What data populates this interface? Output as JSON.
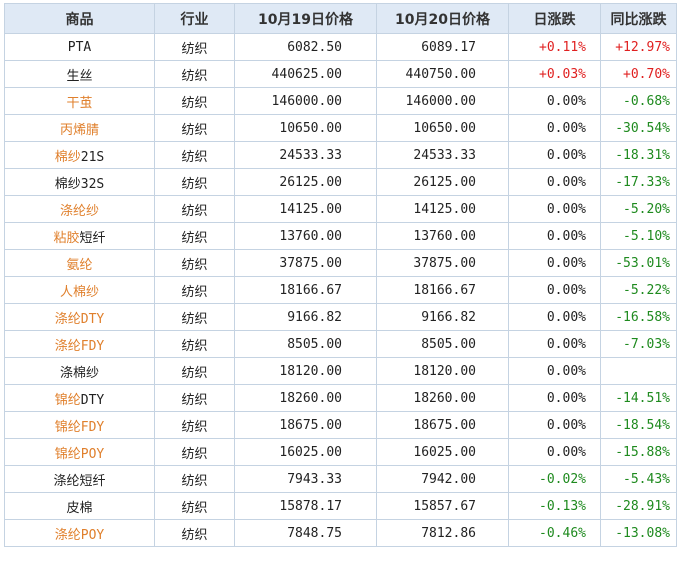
{
  "headers": [
    "商品",
    "行业",
    "10月19日价格",
    "10月20日价格",
    "日涨跌",
    "同比涨跌"
  ],
  "rows": [
    {
      "name": "PTA",
      "link": "",
      "industry": "纺织",
      "p19": "6082.50",
      "p20": "6089.17",
      "day": "+0.11%",
      "yoy": "+12.97%",
      "day_dir": "up",
      "yoy_dir": "up"
    },
    {
      "name": "生丝",
      "link": "",
      "industry": "纺织",
      "p19": "440625.00",
      "p20": "440750.00",
      "day": "+0.03%",
      "yoy": "+0.70%",
      "day_dir": "up",
      "yoy_dir": "up"
    },
    {
      "name": "",
      "link": "干茧",
      "industry": "纺织",
      "p19": "146000.00",
      "p20": "146000.00",
      "day": "0.00%",
      "yoy": "-0.68%",
      "day_dir": "flat",
      "yoy_dir": "down"
    },
    {
      "name": "",
      "link": "丙烯腈",
      "industry": "纺织",
      "p19": "10650.00",
      "p20": "10650.00",
      "day": "0.00%",
      "yoy": "-30.54%",
      "day_dir": "flat",
      "yoy_dir": "down"
    },
    {
      "name": "21S",
      "link": "棉纱",
      "industry": "纺织",
      "p19": "24533.33",
      "p20": "24533.33",
      "day": "0.00%",
      "yoy": "-18.31%",
      "day_dir": "flat",
      "yoy_dir": "down"
    },
    {
      "name": "棉纱32S",
      "link": "",
      "industry": "纺织",
      "p19": "26125.00",
      "p20": "26125.00",
      "day": "0.00%",
      "yoy": "-17.33%",
      "day_dir": "flat",
      "yoy_dir": "down"
    },
    {
      "name": "",
      "link": "涤纶纱",
      "industry": "纺织",
      "p19": "14125.00",
      "p20": "14125.00",
      "day": "0.00%",
      "yoy": "-5.20%",
      "day_dir": "flat",
      "yoy_dir": "down"
    },
    {
      "name": "短纤",
      "link": "粘胶",
      "industry": "纺织",
      "p19": "13760.00",
      "p20": "13760.00",
      "day": "0.00%",
      "yoy": "-5.10%",
      "day_dir": "flat",
      "yoy_dir": "down"
    },
    {
      "name": "",
      "link": "氨纶",
      "industry": "纺织",
      "p19": "37875.00",
      "p20": "37875.00",
      "day": "0.00%",
      "yoy": "-53.01%",
      "day_dir": "flat",
      "yoy_dir": "down"
    },
    {
      "name": "",
      "link": "人棉纱",
      "industry": "纺织",
      "p19": "18166.67",
      "p20": "18166.67",
      "day": "0.00%",
      "yoy": "-5.22%",
      "day_dir": "flat",
      "yoy_dir": "down"
    },
    {
      "name": "",
      "link": "涤纶DTY",
      "industry": "纺织",
      "p19": "9166.82",
      "p20": "9166.82",
      "day": "0.00%",
      "yoy": "-16.58%",
      "day_dir": "flat",
      "yoy_dir": "down"
    },
    {
      "name": "",
      "link": "涤纶FDY",
      "industry": "纺织",
      "p19": "8505.00",
      "p20": "8505.00",
      "day": "0.00%",
      "yoy": "-7.03%",
      "day_dir": "flat",
      "yoy_dir": "down"
    },
    {
      "name": "涤棉纱",
      "link": "",
      "industry": "纺织",
      "p19": "18120.00",
      "p20": "18120.00",
      "day": "0.00%",
      "yoy": "",
      "day_dir": "flat",
      "yoy_dir": "flat"
    },
    {
      "name": "DTY",
      "link": "锦纶",
      "industry": "纺织",
      "p19": "18260.00",
      "p20": "18260.00",
      "day": "0.00%",
      "yoy": "-14.51%",
      "day_dir": "flat",
      "yoy_dir": "down"
    },
    {
      "name": "",
      "link": "锦纶FDY",
      "industry": "纺织",
      "p19": "18675.00",
      "p20": "18675.00",
      "day": "0.00%",
      "yoy": "-18.54%",
      "day_dir": "flat",
      "yoy_dir": "down"
    },
    {
      "name": "",
      "link": "锦纶POY",
      "industry": "纺织",
      "p19": "16025.00",
      "p20": "16025.00",
      "day": "0.00%",
      "yoy": "-15.88%",
      "day_dir": "flat",
      "yoy_dir": "down"
    },
    {
      "name": "涤纶短纤",
      "link": "",
      "industry": "纺织",
      "p19": "7943.33",
      "p20": "7942.00",
      "day": "-0.02%",
      "yoy": "-5.43%",
      "day_dir": "down",
      "yoy_dir": "down"
    },
    {
      "name": "皮棉",
      "link": "",
      "industry": "纺织",
      "p19": "15878.17",
      "p20": "15857.67",
      "day": "-0.13%",
      "yoy": "-28.91%",
      "day_dir": "down",
      "yoy_dir": "down"
    },
    {
      "name": "",
      "link": "涤纶POY",
      "industry": "纺织",
      "p19": "7848.75",
      "p20": "7812.86",
      "day": "-0.46%",
      "yoy": "-13.08%",
      "day_dir": "down",
      "yoy_dir": "down"
    }
  ]
}
